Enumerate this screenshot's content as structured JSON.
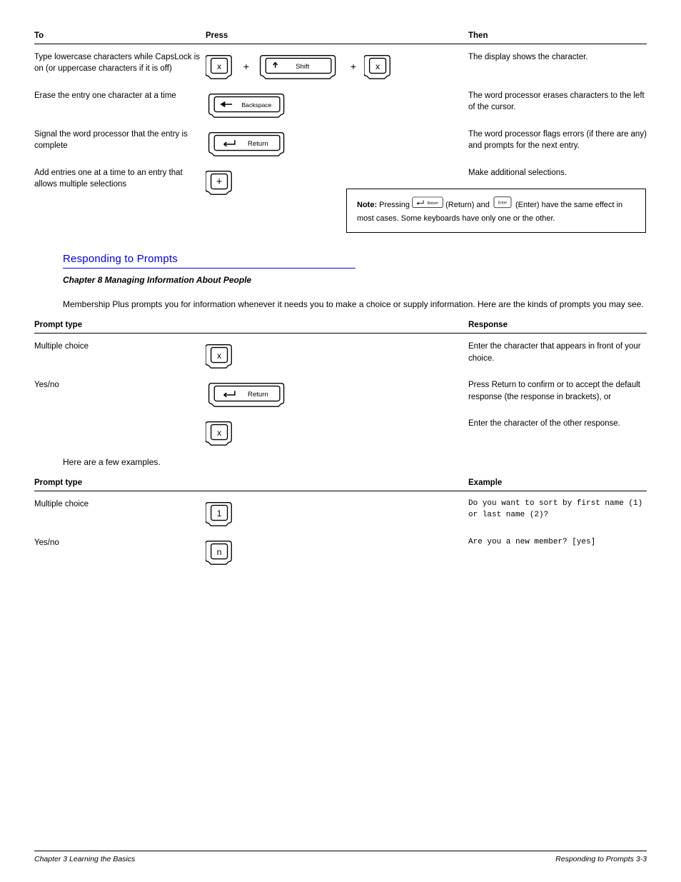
{
  "tableA": {
    "headers": {
      "to": "To",
      "press": "Press",
      "then": "Then"
    },
    "rows": [
      {
        "to": "Type lowercase characters while CapsLock is on (or uppercase characters if it is off)",
        "keys": {
          "seq": [
            "small",
            "plus",
            "wide-shift",
            "plus",
            "small"
          ],
          "small_inner": "x"
        },
        "then": "The display shows the character."
      },
      {
        "to": "Erase the entry one character at a time",
        "keys": {
          "seq": [
            "wide-backspace"
          ]
        },
        "then": "The word processor erases characters to the left of the cursor."
      },
      {
        "to": "Signal the word processor that the entry is complete",
        "keys": {
          "seq": [
            "wide-enter"
          ]
        },
        "then": "The word processor flags errors (if there are any) and prompts for the next entry."
      },
      {
        "to": "Add entries one at a time to an entry that allows multiple selections",
        "keys": {
          "seq": [
            "small"
          ],
          "small_inner": "+"
        },
        "then": "Make additional selections."
      }
    ]
  },
  "note": {
    "label": "Note:",
    "body_a": "Pressing ",
    "body_b": " (Return) and ",
    "body_c": " (Enter) have the same effect in most cases. Some keyboards have only one or the other."
  },
  "heading": "Responding to Prompts",
  "subhead": "Chapter 8 Managing Information About People",
  "para": "Membership Plus prompts you for information whenever it needs you to make a choice or supply information. Here are the kinds of prompts you may see.",
  "tableB": {
    "headers": {
      "type": "Prompt type",
      "response": "Response"
    },
    "rows": [
      {
        "type": "Multiple choice",
        "keys": {
          "seq": [
            "small"
          ],
          "small_inner": "x"
        },
        "response": "Enter the character that appears in front of your choice."
      },
      {
        "type": "Yes/no",
        "keys": {
          "seq": [
            "wide-enter"
          ]
        },
        "response": "Press Return to confirm or to accept the default response (the response in brackets), or"
      },
      {
        "type": "",
        "keys": {
          "seq": [
            "small"
          ],
          "small_inner": "x"
        },
        "response": "Enter the character of the other response."
      }
    ]
  },
  "para2": "Here are a few examples.",
  "tableC": {
    "headers": {
      "type": "Prompt type",
      "example": "Example"
    },
    "rows": [
      {
        "type": "Multiple choice",
        "keys": {
          "seq": [
            "small"
          ],
          "small_inner": "1"
        },
        "response": "Do you want to sort by first name (1) or last name (2)?"
      },
      {
        "type": "Yes/no",
        "keys": {
          "seq": [
            "small"
          ],
          "small_inner": "n"
        },
        "response": "Are you a new member? [yes]"
      }
    ]
  },
  "footer": {
    "left": "Chapter 3 Learning the Basics",
    "right": "Responding to Prompts 3-3"
  }
}
